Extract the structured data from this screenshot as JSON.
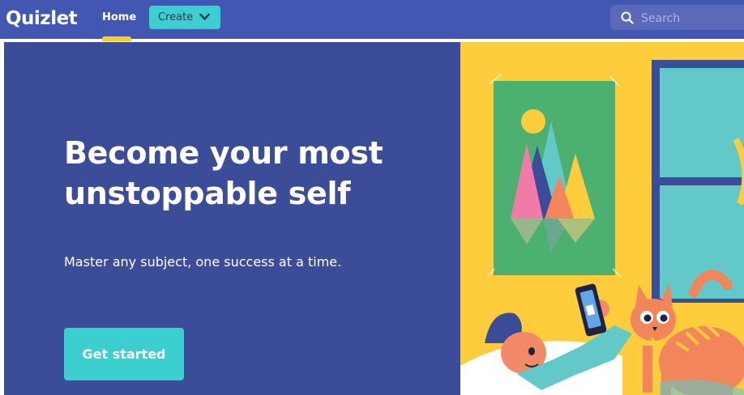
{
  "nav": {
    "logo": "Quizlet",
    "home_label": "Home",
    "create_label": "Create",
    "search_placeholder": "Search"
  },
  "hero": {
    "title_line1": "Become your most",
    "title_line2": "unstoppable self",
    "subtitle": "Master any subject, one success at a time.",
    "cta_label": "Get started"
  },
  "colors": {
    "nav_bg": "#4257b2",
    "hero_bg": "#3b4d99",
    "accent_teal": "#3ccfcf",
    "accent_yellow": "#ffcd1f"
  },
  "icons": {
    "create_chevron": "chevron-down-icon",
    "search": "search-icon"
  }
}
